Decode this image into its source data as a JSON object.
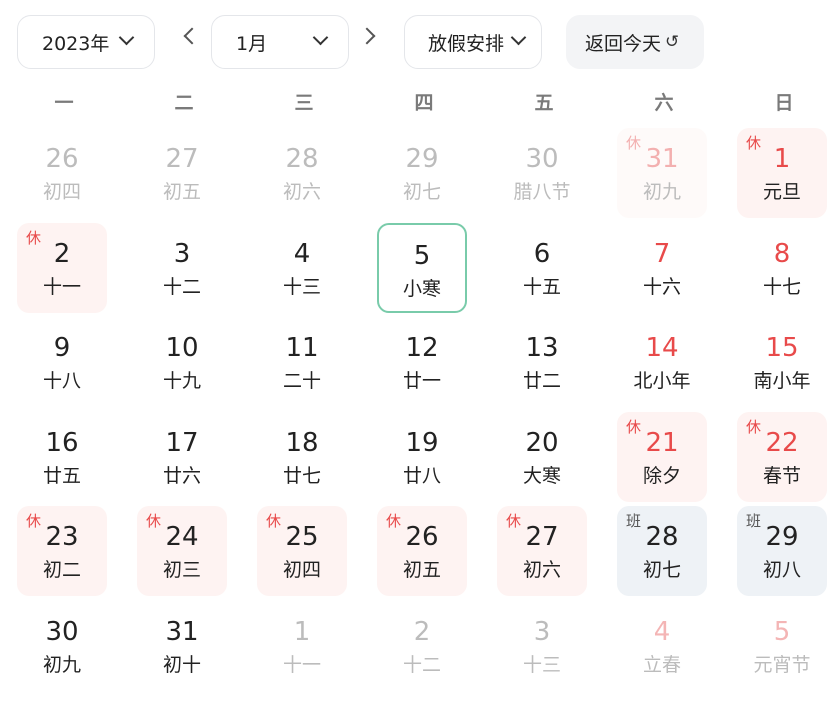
{
  "toolbar": {
    "year": "2023年",
    "month": "1月",
    "holiday": "放假安排",
    "today_label": "返回今天",
    "today_icon": "↺"
  },
  "weekdays": [
    "一",
    "二",
    "三",
    "四",
    "五",
    "六",
    "日"
  ],
  "days": [
    {
      "num": "26",
      "lunar": "初四",
      "other": true
    },
    {
      "num": "27",
      "lunar": "初五",
      "other": true
    },
    {
      "num": "28",
      "lunar": "初六",
      "other": true
    },
    {
      "num": "29",
      "lunar": "初七",
      "other": true
    },
    {
      "num": "30",
      "lunar": "腊八节",
      "other": true
    },
    {
      "num": "31",
      "lunar": "初九",
      "other": true,
      "weekend": true,
      "tag": "休",
      "status": "rest"
    },
    {
      "num": "1",
      "lunar": "元旦",
      "weekend": true,
      "tag": "休",
      "status": "rest"
    },
    {
      "num": "2",
      "lunar": "十一",
      "tag": "休",
      "status": "rest"
    },
    {
      "num": "3",
      "lunar": "十二"
    },
    {
      "num": "4",
      "lunar": "十三"
    },
    {
      "num": "5",
      "lunar": "小寒",
      "today": true
    },
    {
      "num": "6",
      "lunar": "十五"
    },
    {
      "num": "7",
      "lunar": "十六",
      "weekend": true
    },
    {
      "num": "8",
      "lunar": "十七",
      "weekend": true
    },
    {
      "num": "9",
      "lunar": "十八"
    },
    {
      "num": "10",
      "lunar": "十九"
    },
    {
      "num": "11",
      "lunar": "二十"
    },
    {
      "num": "12",
      "lunar": "廿一"
    },
    {
      "num": "13",
      "lunar": "廿二"
    },
    {
      "num": "14",
      "lunar": "北小年",
      "weekend": true
    },
    {
      "num": "15",
      "lunar": "南小年",
      "weekend": true
    },
    {
      "num": "16",
      "lunar": "廿五"
    },
    {
      "num": "17",
      "lunar": "廿六"
    },
    {
      "num": "18",
      "lunar": "廿七"
    },
    {
      "num": "19",
      "lunar": "廿八"
    },
    {
      "num": "20",
      "lunar": "大寒"
    },
    {
      "num": "21",
      "lunar": "除夕",
      "weekend": true,
      "tag": "休",
      "status": "rest"
    },
    {
      "num": "22",
      "lunar": "春节",
      "weekend": true,
      "tag": "休",
      "status": "rest"
    },
    {
      "num": "23",
      "lunar": "初二",
      "tag": "休",
      "status": "rest"
    },
    {
      "num": "24",
      "lunar": "初三",
      "tag": "休",
      "status": "rest"
    },
    {
      "num": "25",
      "lunar": "初四",
      "tag": "休",
      "status": "rest"
    },
    {
      "num": "26",
      "lunar": "初五",
      "tag": "休",
      "status": "rest"
    },
    {
      "num": "27",
      "lunar": "初六",
      "tag": "休",
      "status": "rest"
    },
    {
      "num": "28",
      "lunar": "初七",
      "tag": "班",
      "status": "work"
    },
    {
      "num": "29",
      "lunar": "初八",
      "tag": "班",
      "status": "work"
    },
    {
      "num": "30",
      "lunar": "初九"
    },
    {
      "num": "31",
      "lunar": "初十"
    },
    {
      "num": "1",
      "lunar": "十一",
      "other": true
    },
    {
      "num": "2",
      "lunar": "十二",
      "other": true
    },
    {
      "num": "3",
      "lunar": "十三",
      "other": true
    },
    {
      "num": "4",
      "lunar": "立春",
      "other": true,
      "weekend": true
    },
    {
      "num": "5",
      "lunar": "元宵节",
      "other": true,
      "weekend": true
    }
  ]
}
